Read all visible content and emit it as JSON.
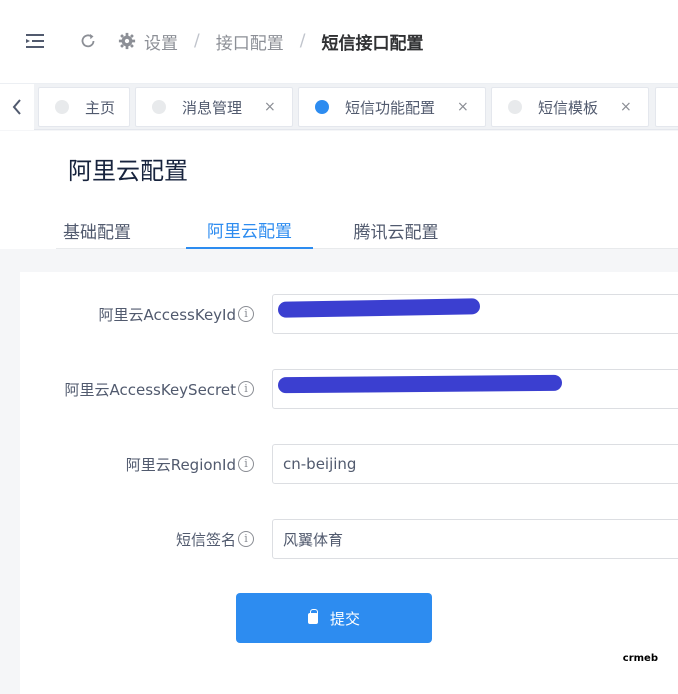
{
  "breadcrumb": {
    "root": "设置",
    "parent": "接口配置",
    "current": "短信接口配置",
    "separator": "/"
  },
  "tabs": [
    {
      "label": "主页",
      "closable": false,
      "active": false
    },
    {
      "label": "消息管理",
      "closable": true,
      "active": false
    },
    {
      "label": "短信功能配置",
      "closable": true,
      "active": true
    },
    {
      "label": "短信模板",
      "closable": true,
      "active": false
    }
  ],
  "page": {
    "title": "阿里云配置"
  },
  "subtabs": [
    {
      "label": "基础配置",
      "active": false
    },
    {
      "label": "阿里云配置",
      "active": true
    },
    {
      "label": "腾讯云配置",
      "active": false
    }
  ],
  "form": {
    "access_key_id": {
      "label": "阿里云AccessKeyId",
      "value": ""
    },
    "access_key_secret": {
      "label": "阿里云AccessKeySecret",
      "value": ""
    },
    "region_id": {
      "label": "阿里云RegionId",
      "value": "cn-beijing"
    },
    "sign_name": {
      "label": "短信签名",
      "value": "风翼体育"
    },
    "info_glyph": "i"
  },
  "submit": {
    "label": "提交"
  },
  "watermark": "crmeb",
  "icons": {
    "close": "×",
    "left": "‹"
  },
  "colors": {
    "accent": "#2d8cf0",
    "redaction": "#3b3fd0"
  }
}
